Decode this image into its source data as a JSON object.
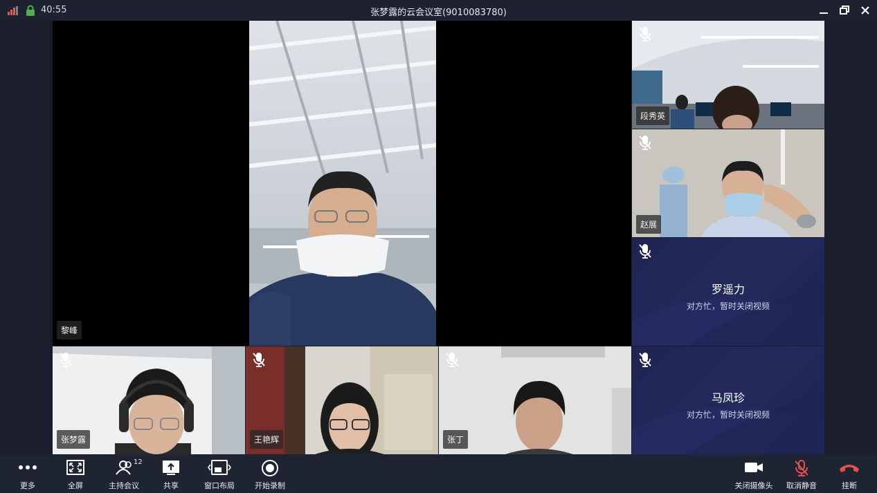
{
  "titlebar": {
    "time": "40:55",
    "title": "张梦露的云会议室(9010083780)"
  },
  "participants": {
    "main": {
      "name": "黎峰"
    },
    "top_right_1": {
      "name": "段秀英"
    },
    "top_right_2": {
      "name": "赵展"
    },
    "avatar_1": {
      "name": "罗遥力",
      "status": "对方忙，暂时关闭视频"
    },
    "avatar_2": {
      "name": "马凤珍",
      "status": "对方忙，暂时关闭视频"
    },
    "bottom_1": {
      "name": "张梦露"
    },
    "bottom_2": {
      "name": "王艳辉"
    },
    "bottom_3": {
      "name": "张丁"
    }
  },
  "toolbar": {
    "more": "更多",
    "fullscreen": "全屏",
    "host": "主持会议",
    "host_count": "12",
    "share": "共享",
    "layout": "窗口布局",
    "record": "开始录制",
    "camera_off": "关闭摄像头",
    "unmute": "取消静音",
    "hangup": "挂断"
  },
  "colors": {
    "mute_red": "#e8504a",
    "hangup_red": "#e8504a",
    "toolbar_bg": "#1f2433",
    "avatar_bg": "#22285a"
  }
}
